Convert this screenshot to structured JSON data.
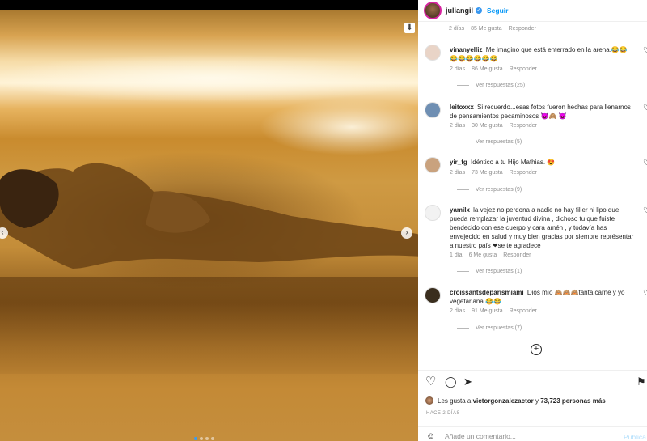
{
  "post": {
    "username": "juliangil",
    "follow_label": "Seguir",
    "verified_glyph": "✓",
    "save_glyph": "⬇",
    "prev_glyph": "‹",
    "next_glyph": "›",
    "carousel": {
      "count": 4,
      "active_index": 0
    }
  },
  "first_comment_meta": {
    "time": "2 días",
    "likes": "85 Me gusta",
    "reply": "Responder"
  },
  "comments": [
    {
      "user": "vinanyelliz",
      "text": "Me imagino que está enterrado en la arena.😂😂😂😂😂😂😂😂",
      "time": "2 días",
      "likes": "86 Me gusta",
      "reply": "Responder",
      "view_replies": "Ver respuestas (25)",
      "avatar_color": "#e9d4c7"
    },
    {
      "user": "leitoxxx",
      "text": "Si recuerdo...esas fotos fueron hechas para llenarnos de pensamientos pecaminosos 😈🙈 😈",
      "time": "2 días",
      "likes": "30 Me gusta",
      "reply": "Responder",
      "view_replies": "Ver respuestas (5)",
      "avatar_color": "#6f8fb3"
    },
    {
      "user": "yir_fg",
      "text": "Idéntico a tu Hijo Mathias. 😍",
      "time": "2 días",
      "likes": "73 Me gusta",
      "reply": "Responder",
      "view_replies": "Ver respuestas (9)",
      "avatar_color": "#c9a27e"
    },
    {
      "user": "yamilx",
      "text": "la vejez no perdona a nadie no hay filler ni lipo que pueda remplazar la juventud divina , dichoso tu que fuiste bendecido con ese cuerpo y cara amén , y todavía has envejecido en salud y muy bien gracias por siempre représentar a nuestro país ❤se te agradece",
      "time": "1 día",
      "likes": "6 Me gusta",
      "reply": "Responder",
      "view_replies": "Ver respuestas (1)",
      "avatar_color": "#f2f2f2"
    },
    {
      "user": "croissantsdeparismiami",
      "text": "Dios mío 🙈🙈🙈tanta carne y yo vegetariana 😂😂",
      "time": "2 días",
      "likes": "91 Me gusta",
      "reply": "Responder",
      "view_replies": "Ver respuestas (7)",
      "avatar_color": "#3a2e1e"
    }
  ],
  "icons": {
    "heart": "♡",
    "comment": "◯",
    "share": "➤",
    "bookmark": "⚑",
    "load_more": "+",
    "emoji": "☺"
  },
  "likes_line": {
    "prefix": "Les gusta a",
    "user": "victorgonzalezactor",
    "middle": "y",
    "count": "73,723 personas más"
  },
  "post_date": "HACE 2 DÍAS",
  "add_comment": {
    "placeholder": "Añade un comentario...",
    "publish_label": "Publica"
  }
}
